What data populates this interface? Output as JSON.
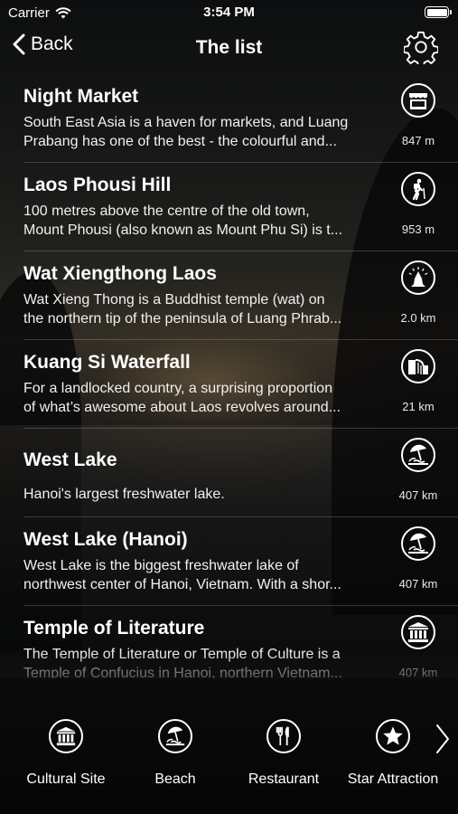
{
  "status_bar": {
    "carrier": "Carrier",
    "time": "3:54 PM"
  },
  "nav": {
    "back_label": "Back",
    "title": "The list"
  },
  "places": [
    {
      "name": "Night Market",
      "desc_lines": [
        "South East Asia is a haven for markets, and Luang",
        "Prabang has one of the best - the colourful and..."
      ],
      "distance": "847 m",
      "icon": "market-stall-icon"
    },
    {
      "name": "Laos Phousi Hill",
      "desc_lines": [
        "100 metres above the centre of the old town,",
        "Mount Phousi (also known as Mount Phu Si) is t..."
      ],
      "distance": "953 m",
      "icon": "hiker-icon"
    },
    {
      "name": "Wat Xiengthong Laos",
      "desc_lines": [
        "Wat Xieng Thong is a Buddhist temple (wat) on",
        "the northern tip of the peninsula of Luang Phrab..."
      ],
      "distance": "2.0 km",
      "icon": "praying-hands-icon"
    },
    {
      "name": "Kuang Si Waterfall",
      "desc_lines": [
        "For a landlocked country, a surprising proportion",
        "of what’s awesome about Laos revolves around..."
      ],
      "distance": "21 km",
      "icon": "waterfall-icon"
    },
    {
      "name": "West Lake",
      "desc_lines": [
        "Hanoi's largest freshwater lake."
      ],
      "distance": "407 km",
      "icon": "beach-umbrella-icon"
    },
    {
      "name": "West Lake (Hanoi)",
      "desc_lines": [
        "West Lake is the biggest freshwater lake of",
        "northwest center of Hanoi, Vietnam. With a shor..."
      ],
      "distance": "407 km",
      "icon": "beach-umbrella-icon"
    },
    {
      "name": "Temple of Literature",
      "desc_lines": [
        "The Temple of Literature or Temple of Culture is a",
        "Temple of Confucius in Hanoi, northern Vietnam..."
      ],
      "distance": "407 km",
      "icon": "temple-columns-icon"
    }
  ],
  "categories": [
    {
      "label": "Cultural Site",
      "icon": "temple-columns-icon"
    },
    {
      "label": "Beach",
      "icon": "beach-umbrella-icon"
    },
    {
      "label": "Restaurant",
      "icon": "fork-knife-icon"
    },
    {
      "label": "Star Attraction",
      "icon": "star-icon"
    }
  ]
}
